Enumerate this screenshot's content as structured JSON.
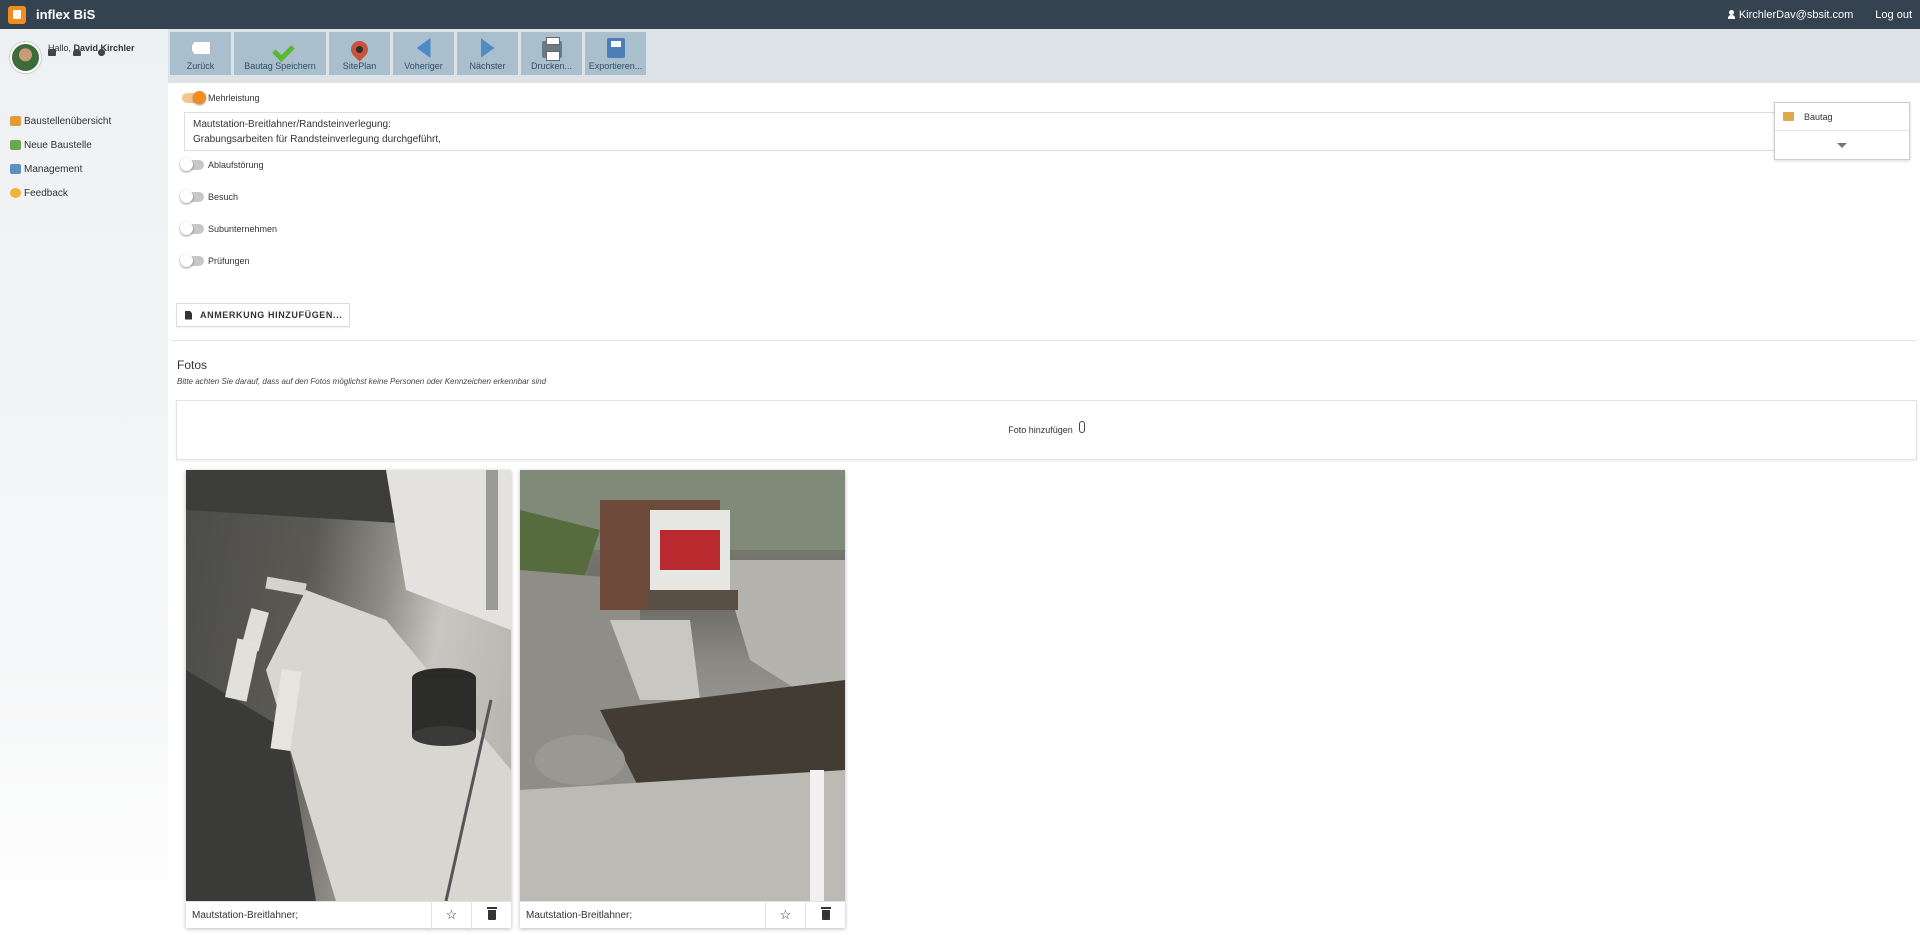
{
  "app": {
    "title": "inflex BiS"
  },
  "topbar": {
    "user_email": "KirchlerDav@sbsit.com",
    "logout": "Log out"
  },
  "profile": {
    "greeting": "Hallo,",
    "name": "David Kirchler"
  },
  "nav": [
    {
      "label": "Baustellenübersicht",
      "icon": "site-overview-icon",
      "color": "#e39b3a"
    },
    {
      "label": "Neue Baustelle",
      "icon": "new-site-icon",
      "color": "#6aa84f"
    },
    {
      "label": "Management",
      "icon": "management-icon",
      "color": "#5c8fc2"
    },
    {
      "label": "Feedback",
      "icon": "feedback-icon",
      "color": "#f1b434"
    }
  ],
  "toolbar": {
    "back": "Zurück",
    "save": "Bautag Speichern",
    "siteplan": "SitePlan",
    "previous": "Voheriger",
    "next": "Nächster",
    "print": "Drucken...",
    "export": "Exportieren..."
  },
  "form": {
    "mehrleistung": "Mehrleistung",
    "description_lines": [
      "Mautstation-Breitlahner/Randsteinverlegung:",
      "Grabungsarbeiten für Randsteinverlegung durchgeführt,"
    ],
    "toggles": [
      "Ablaufstörung",
      "Besuch",
      "Subunternehmen",
      "Prüfungen"
    ],
    "add_note": "ANMERKUNG HINZUFÜGEN..."
  },
  "side_dropdown": {
    "item": "Bautag"
  },
  "photos": {
    "title": "Fotos",
    "hint": "Bitte achten Sie darauf, dass auf den Fotos möglichst keine Personen oder Kennzeichen erkennbar sind",
    "add_label": "Foto hinzufügen",
    "items": [
      {
        "caption": "Mautstation-Breitlahner;"
      },
      {
        "caption": "Mautstation-Breitlahner;"
      }
    ]
  },
  "colors": {
    "topbar": "#34434f",
    "accent": "#f28c1e",
    "toolbar_button": "#a9bfcd"
  }
}
